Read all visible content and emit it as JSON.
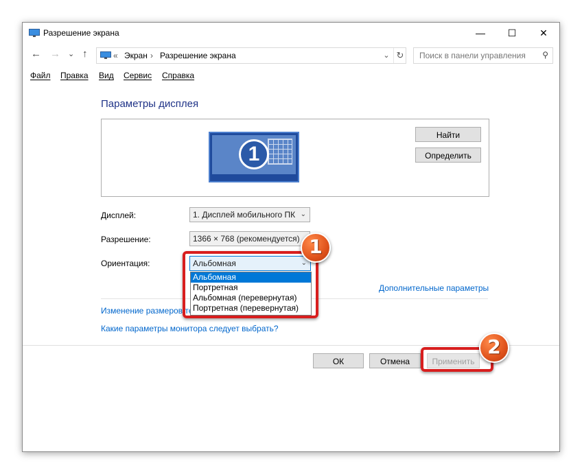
{
  "window": {
    "title": "Разрешение экрана",
    "controls": {
      "minimize": "—",
      "maximize": "☐",
      "close": "✕"
    }
  },
  "nav": {
    "back": "←",
    "forward": "→",
    "recent": "⌄",
    "up": "↑",
    "breadcrumb_prefix": "«",
    "breadcrumbs": [
      "Экран",
      "Разрешение экрана"
    ],
    "separator": "›",
    "search_placeholder": "Поиск в панели управления"
  },
  "menu": [
    "Файл",
    "Правка",
    "Вид",
    "Сервис",
    "Справка"
  ],
  "main": {
    "heading": "Параметры дисплея",
    "monitor_number": "1",
    "find_button": "Найти",
    "identify_button": "Определить",
    "display_label": "Дисплей:",
    "display_value": "1. Дисплей мобильного ПК",
    "resolution_label": "Разрешение:",
    "resolution_value": "1366 × 768 (рекомендуется)",
    "orientation_label": "Ориентация:",
    "orientation_value": "Альбомная",
    "orientation_options": [
      "Альбомная",
      "Портретная",
      "Альбомная (перевернутая)",
      "Портретная (перевернутая)"
    ],
    "advanced_link": "Дополнительные параметры",
    "resize_link": "Изменение размеров текста и других элементов",
    "monitor_help_link": "Какие параметры монитора следует выбрать?"
  },
  "footer": {
    "ok": "ОК",
    "cancel": "Отмена",
    "apply": "Применить"
  },
  "annotations": {
    "badge_1": "1",
    "badge_2": "2",
    "highlight_color": "#d81e1e",
    "badge_color": "#e0531c"
  },
  "colors": {
    "heading": "#1e3287",
    "link": "#0066cc",
    "selection": "#0078d7"
  }
}
